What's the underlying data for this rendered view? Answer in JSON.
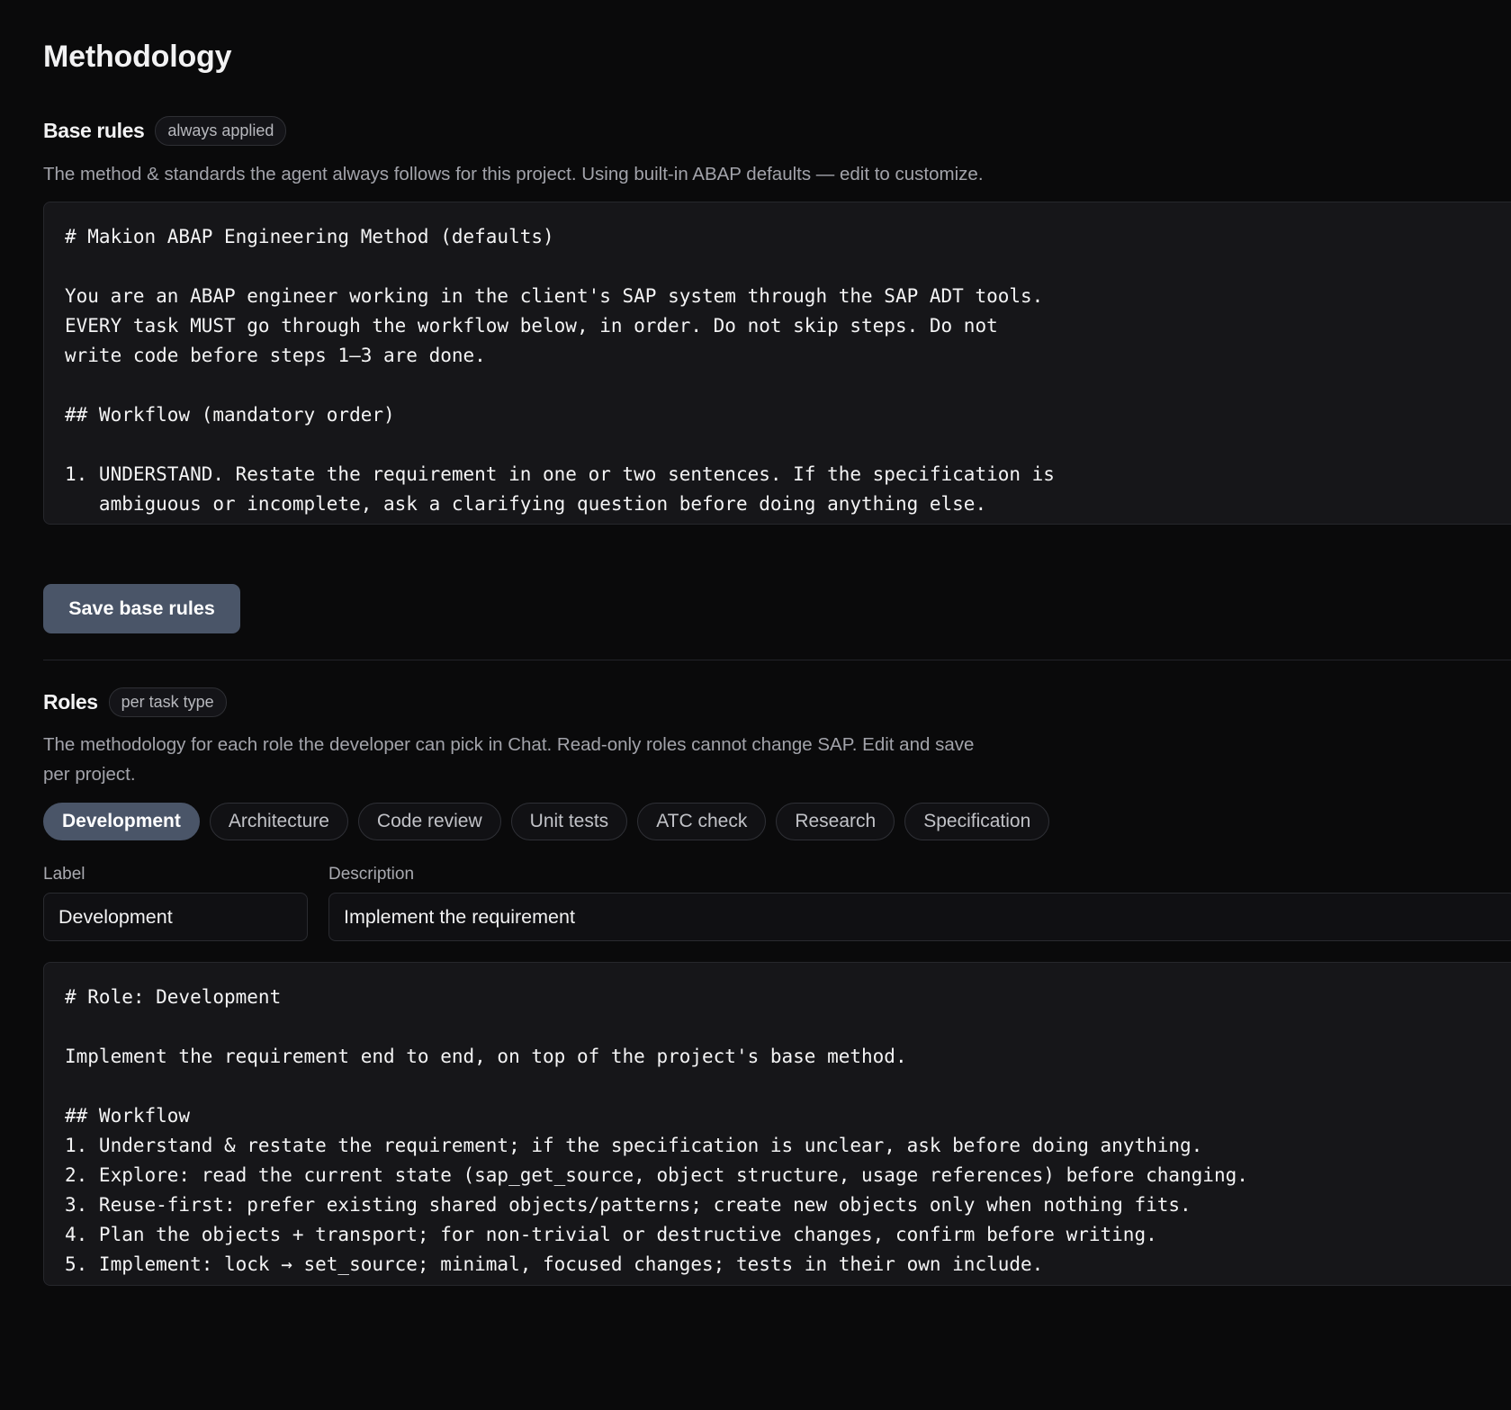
{
  "page": {
    "title": "Methodology"
  },
  "base_rules": {
    "title": "Base rules",
    "badge": "always applied",
    "help": "The method & standards the agent always follows for this project. Using built-in ABAP defaults — edit to customize.",
    "content": "# Makion ABAP Engineering Method (defaults)\n\nYou are an ABAP engineer working in the client's SAP system through the SAP ADT tools.\nEVERY task MUST go through the workflow below, in order. Do not skip steps. Do not\nwrite code before steps 1–3 are done.\n\n## Workflow (mandatory order)\n\n1. UNDERSTAND. Restate the requirement in one or two sentences. If the specification is\n   ambiguous or incomplete, ask a clarifying question before doing anything else.",
    "save_label": "Save base rules"
  },
  "roles": {
    "title": "Roles",
    "badge": "per task type",
    "help_line1": "The methodology for each role the developer can pick in Chat. Read-only roles cannot change SAP. Edit and save",
    "help_line2": "per project.",
    "tabs": [
      "Development",
      "Architecture",
      "Code review",
      "Unit tests",
      "ATC check",
      "Research",
      "Specification"
    ],
    "active_tab": "Development",
    "label_caption": "Label",
    "label_value": "Development",
    "description_caption": "Description",
    "description_value": "Implement the requirement",
    "content": "# Role: Development\n\nImplement the requirement end to end, on top of the project's base method.\n\n## Workflow\n1. Understand & restate the requirement; if the specification is unclear, ask before doing anything.\n2. Explore: read the current state (sap_get_source, object structure, usage references) before changing.\n3. Reuse-first: prefer existing shared objects/patterns; create new objects only when nothing fits.\n4. Plan the objects + transport; for non-trivial or destructive changes, confirm before writing.\n5. Implement: lock → set_source; minimal, focused changes; tests in their own include."
  }
}
